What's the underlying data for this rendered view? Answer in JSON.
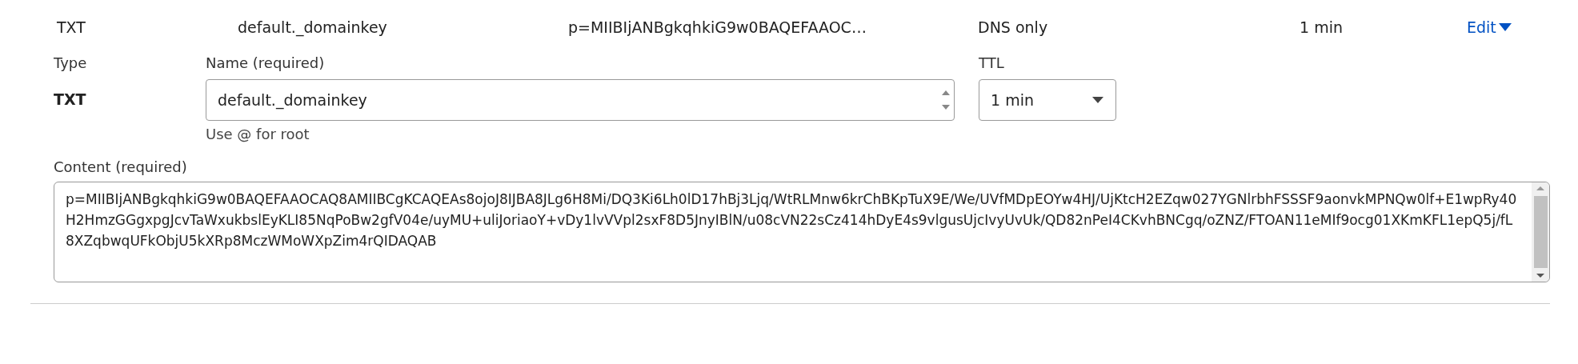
{
  "record_row": {
    "type": "TXT",
    "name": "default._domainkey",
    "content": "p=MIIBIjANBgkqhkiG9w0BAQEFAAOC…",
    "proxy_status": "DNS only",
    "ttl": "1 min",
    "edit_link": "Edit",
    "expanded": true
  },
  "editor": {
    "type_label": "Type",
    "type_value": "TXT",
    "name_label": "Name (required)",
    "name_value": "default._domainkey",
    "name_hint": "Use @ for root",
    "ttl_label": "TTL",
    "ttl_value": "1 min",
    "content_label": "Content (required)",
    "content_value": "p=MIIBIjANBgkqhkiG9w0BAQEFAAOCAQ8AMIIBCgKCAQEAs8ojoJ8IJBA8JLg6H8Mi/DQ3Ki6Lh0lD17hBj3Ljq/WtRLMnw6krChBKpTuX9E/We/UVfMDpEOYw4HJ/UjKtcH2EZqw027YGNlrbhFSSSF9aonvkMPNQw0lf+E1wpRy40H2HmzGGgxpgJcvTaWxukbslEyKLI85NqPoBw2gfV04e/uyMU+uliJoriaoY+vDy1lvVVpl2sxF8D5JnyIBlN/u08cVN22sCz414hDyE4s9vlgusUjcIvyUvUk/QD82nPeI4CKvhBNCgq/oZNZ/FTOAN11eMIf9ocg01XKmKFL1epQ5j/fL8XZqbwqUFkObjU5kXRp8MczWMoWXpZim4rQIDAQAB"
  }
}
